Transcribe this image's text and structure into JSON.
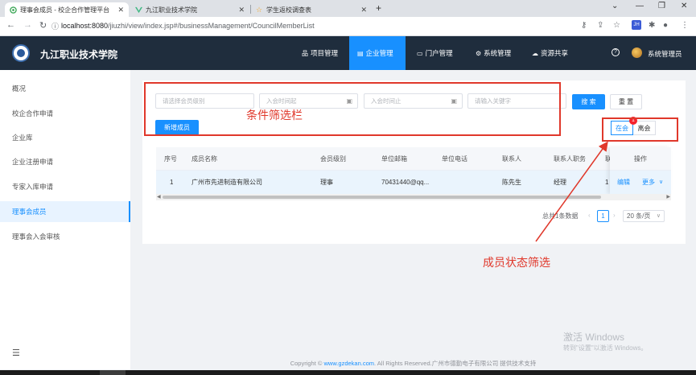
{
  "browser": {
    "tabs": [
      {
        "title": "理事会成员 - 校企合作管理平台",
        "active": true
      },
      {
        "title": "九江职业技术学院",
        "active": false
      },
      {
        "title": "学生返校调查表",
        "active": false
      }
    ],
    "url_host": "localhost:8080",
    "url_path": "/jiuzhi/view/index.jsp#/businessManagement/CouncilMemberList",
    "window_controls": [
      "minimize-icon",
      "restore-icon",
      "close-icon"
    ]
  },
  "header": {
    "school": "九江职业技术学院",
    "nav": [
      {
        "label": "项目管理",
        "icon": "sitemap-icon",
        "active": false
      },
      {
        "label": "企业管理",
        "icon": "document-icon",
        "active": true
      },
      {
        "label": "门户管理",
        "icon": "monitor-icon",
        "active": false
      },
      {
        "label": "系统管理",
        "icon": "gear-icon",
        "active": false
      },
      {
        "label": "资源共享",
        "icon": "cloud-icon",
        "active": false
      }
    ],
    "user": "系统管理员"
  },
  "sidebar": {
    "items": [
      {
        "label": "概况",
        "active": false
      },
      {
        "label": "校企合作申请",
        "active": false
      },
      {
        "label": "企业库",
        "active": false
      },
      {
        "label": "企业注册申请",
        "active": false
      },
      {
        "label": "专家入库申请",
        "active": false
      },
      {
        "label": "理事会成员",
        "active": true
      },
      {
        "label": "理事会入会审核",
        "active": false
      }
    ],
    "collapse_icon": "menu-fold-icon"
  },
  "filters": {
    "level_placeholder": "请选择会员级别",
    "date_start_placeholder": "入会时间起",
    "date_end_placeholder": "入会时间止",
    "keyword_placeholder": "请输入关键字",
    "search_label": "搜 索",
    "reset_label": "重 置",
    "add_label": "新增成员"
  },
  "status_tabs": {
    "badge": "1",
    "active_label": "在会",
    "left_label": "离会"
  },
  "table": {
    "columns": [
      "序号",
      "成员名称",
      "会员级别",
      "单位邮箱",
      "单位电话",
      "联系人",
      "联系人职务",
      "联",
      "操作"
    ],
    "rows": [
      {
        "index": "1",
        "name": "广州市先进制造有限公司",
        "level": "理事",
        "email": "70431440@qq...",
        "phone": "",
        "contact": "陈先生",
        "title": "经理",
        "extra": "1",
        "edit_label": "编辑",
        "more_label": "更多"
      }
    ]
  },
  "pagination": {
    "total_text": "总共1条数据",
    "current_page": "1",
    "page_size": "20 条/页"
  },
  "annotations": {
    "filter_bar": "条件筛选栏",
    "status_filter": "成员状态筛选",
    "color": "#e0382b"
  },
  "footer": {
    "prefix": "Copyright ",
    "link": "www.gzdekan.com",
    "suffix": ". All Rights Reserved.广州市德勤电子有限公司 提供技术支持"
  },
  "watermark": {
    "line1": "激活 Windows",
    "line2": "转到\"设置\"以激活 Windows。"
  }
}
